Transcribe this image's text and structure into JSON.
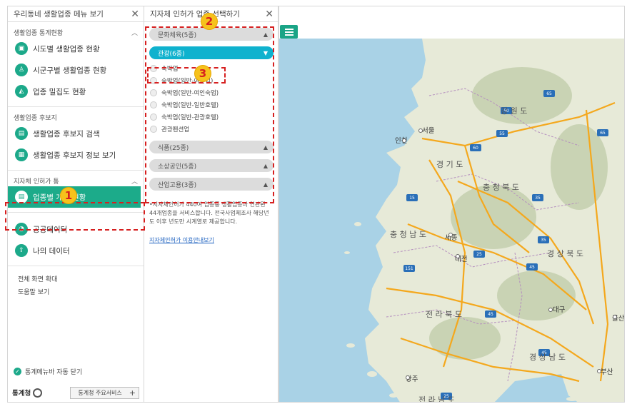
{
  "left_panel": {
    "title": "우리동네 생활업종 메뉴 보기",
    "sections": [
      {
        "title": "생활업종 통계현황",
        "items": [
          "시도별 생활업종 현황",
          "시군구별 생활업종 현황",
          "업종 밀집도 현황"
        ]
      },
      {
        "title": "생활업종 후보지",
        "items": [
          "생활업종 후보지 검색",
          "생활업종 후보지 정보 보기"
        ]
      },
      {
        "title": "지자체 인허가 통",
        "items": [
          "업종별 개업 현황"
        ]
      },
      {
        "title": "",
        "items": [
          "공공데이터",
          "나의 데이터"
        ]
      }
    ],
    "links": [
      "전체 화면 확대",
      "도움말 보기"
    ],
    "auto_close_label": "통계메뉴바 자동 닫기",
    "logo_text": "통계청",
    "service_button": "통계청 주요서비스"
  },
  "mid_panel": {
    "title": "지자체 인허가 업종 선택하기",
    "categories": [
      {
        "label": "문화체육(5종)"
      },
      {
        "label": "관광(6종)"
      },
      {
        "label": "식품(25종)"
      },
      {
        "label": "소상공인(5종)"
      },
      {
        "label": "산업고용(3종)"
      }
    ],
    "tourism_items": [
      "숙박업",
      "숙박업(일반-여관업)",
      "숙박업(일반-여인숙업)",
      "숙박업(일반-일반호텔)",
      "숙박업(일반-관광호텔)",
      "관광펜션업"
    ],
    "info_text": "•지자체인허가 440여 업종중 생활업종과 연관된 44개업종을 서비스합니다. 전국사업체조사 해당년도 이후 년도만 시계열로 제공합니다.",
    "guide_link": "지자체인허가 이용안내보기"
  },
  "map": {
    "region_labels": [
      "강 원 도",
      "경 기 도",
      "충 청 북 도",
      "충 청 남 도",
      "경 상 북 도",
      "전 라 북 도",
      "경 상 남 도",
      "전 라 남 도"
    ],
    "city_labels": [
      "인천",
      "서울",
      "세종",
      "대전",
      "대구",
      "울산",
      "광주",
      "부산"
    ],
    "road_numbers": [
      "65",
      "50",
      "60",
      "55",
      "65",
      "35",
      "35",
      "45",
      "25",
      "151",
      "15",
      "45",
      "25",
      "45"
    ]
  },
  "annotations": {
    "badge1": "1",
    "badge2": "2",
    "badge3": "3"
  },
  "colors": {
    "accent": "#1cab8a",
    "category_open": "#0fb2ce",
    "annotation": "#d61f1f",
    "badge": "#f6c21c"
  }
}
